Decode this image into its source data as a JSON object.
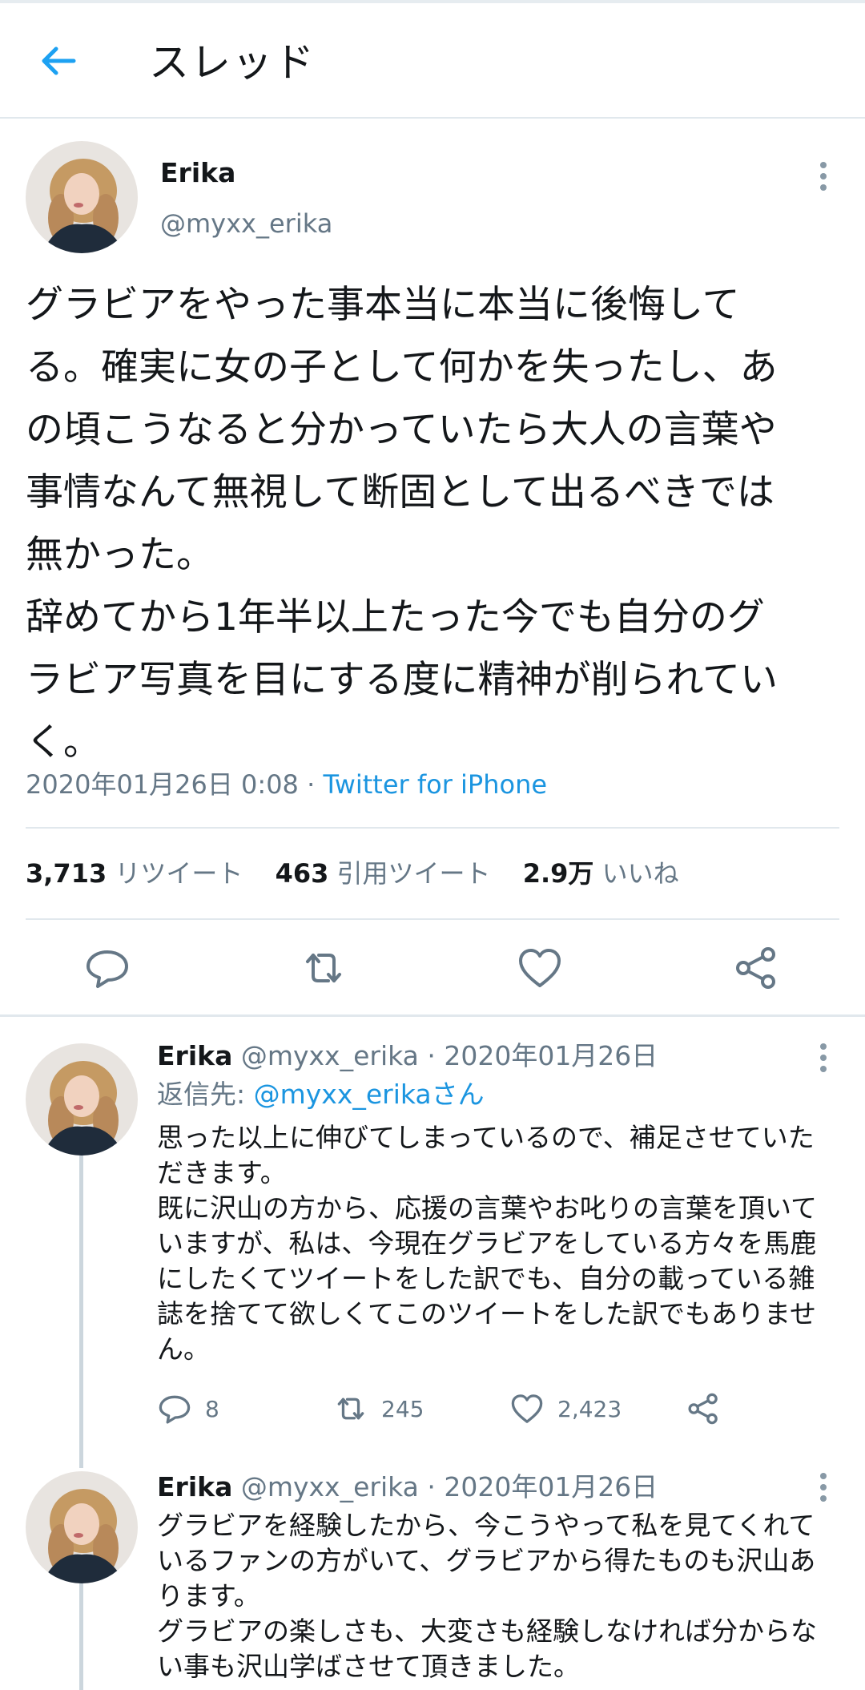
{
  "header": {
    "title": "スレッド",
    "back_icon": "arrow-left-icon",
    "accent": "#1da1f2"
  },
  "main_tweet": {
    "name": "Erika",
    "handle": "@myxx_erika",
    "text": "グラビアをやった事本当に本当に後悔して\nる。確実に女の子として何かを失ったし、あ\nの頃こうなると分かっていたら大人の言葉や\n事情なんて無視して断固として出るべきでは\n無かった。\n辞めてから1年半以上たった今でも自分のグ\nラビア写真を目にする度に精神が削られてい\nく。",
    "timestamp": "2020年01月26日 0:08",
    "dot": " · ",
    "source": "Twitter for iPhone",
    "stats": {
      "retweets_count": "3,713",
      "retweets_label": "リツイート",
      "quotes_count": "463",
      "quotes_label": "引用ツイート",
      "likes_count": "2.9万",
      "likes_label": "いいね"
    },
    "actions": [
      "reply-icon",
      "retweet-icon",
      "like-icon",
      "share-icon"
    ]
  },
  "replies": [
    {
      "name": "Erika",
      "handle_date": "@myxx_erika · 2020年01月26日",
      "reply_to_label": "返信先: ",
      "reply_to_user": "@myxx_erikaさん",
      "text": "思った以上に伸びてしまっているので、補足させていた\nだきます。\n既に沢山の方から、応援の言葉やお叱りの言葉を頂いて\nいますが、私は、今現在グラビアをしている方々を馬鹿\nにしたくてツイートをした訳でも、自分の載っている雑\n誌を捨てて欲しくてこのツイートをした訳でもありませ\nん。",
      "reply_count": "8",
      "retweet_count": "245",
      "like_count": "2,423"
    },
    {
      "name": "Erika",
      "handle_date": "@myxx_erika · 2020年01月26日",
      "text": "グラビアを経験したから、今こうやって私を見てくれて\nいるファンの方がいて、グラビアから得たものも沢山あ\nります。\nグラビアの楽しさも、大変さも経験しなければ分からな\nい事も沢山学ばさせて頂きました。"
    }
  ]
}
